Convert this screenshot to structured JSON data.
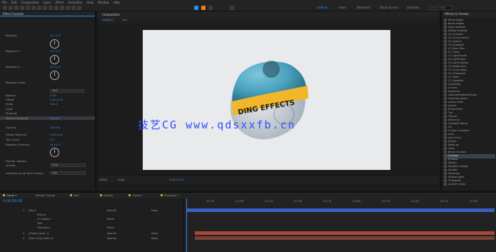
{
  "menubar": {
    "items": [
      "File",
      "Edit",
      "Composition",
      "Layer",
      "Effect",
      "Animation",
      "View",
      "Window",
      "Help"
    ]
  },
  "toolbar": {
    "workspaces": [
      "Default",
      "Learn",
      "Standard",
      "Small Screen",
      "Libraries"
    ],
    "search_placeholder": "Search Help"
  },
  "effect_controls": {
    "tab_label": "Effect Controls",
    "rows": [
      {
        "name": "Rotation",
        "value": "0x+0.0°"
      },
      {
        "name": "Rotation Y",
        "value": "0x+0.0°"
      },
      {
        "name": "Rotation Z",
        "value": "0x+0.0°"
      },
      {
        "name": "Rotation Order",
        "value": "XYZ"
      },
      {
        "name": "Normal",
        "value": "0.00"
      },
      {
        "name": "Offset",
        "value": "0.00,0.00"
      },
      {
        "name": "Scale",
        "value": "100.0"
      },
      {
        "name": "Light",
        "value": ""
      },
      {
        "name": "Shading",
        "value": ""
      },
      {
        "name": "Texture Mapping",
        "value": "Sphere"
      },
      {
        "name": "Opacity",
        "value": "100.0%"
      },
      {
        "name": "Offset (Texture)",
        "value": "0.00,0.00"
      },
      {
        "name": "Tile Count",
        "value": "1.0"
      },
      {
        "name": "Rotation (Texture)",
        "value": "0x+0.0°"
      },
      {
        "name": "Render Options",
        "value": ""
      },
      {
        "name": "Quality",
        "value": "Final"
      },
      {
        "name": "Antialiasing for Best Quality",
        "value": "Low"
      }
    ]
  },
  "viewer": {
    "tab_label": "Composition",
    "sub_tabs": [
      "Comp 1",
      "Text"
    ],
    "zoom": "(50%)",
    "resolution": "(Full)",
    "time": "0;00;00;00",
    "object_text": "DING EFFECTS",
    "watermark": "技艺CG  www.qdsxxfb.cn"
  },
  "effects_panel": {
    "header": "Effects & Presets",
    "items": [
      "Bevel Alpha",
      "Bevel Edges",
      "Drop Shadow",
      "Radial Shadow",
      "CC Cylinder",
      "CC Environment",
      "CC Sphere",
      "CC Spotlight",
      "CC Burn Film",
      "CC Glass",
      "CC Light Burst",
      "CC Light Rays",
      "CC Light Sweep",
      "CC Radial Blur",
      "CC Scale Wipe",
      "CC Threshold",
      "CC Toner",
      "CC Vignette",
      "Colorama",
      "Curves",
      "Exposure",
      "Gamma/Pedestal/Gain",
      "Hue/Saturation",
      "Leave Color",
      "Levels",
      "Photo Filter",
      "Tint",
      "Tritone",
      "Vibrance",
      "Gradient Ramp",
      "Fill",
      "4-Color Gradient",
      "Grid",
      "Lens Flare",
      "Stroke",
      "Write-on",
      "Glow",
      "Brush Strokes",
      "Cartoon",
      "Emboss",
      "Mosaic",
      "Roughen Edges",
      "Scatter",
      "Texturize",
      "Strobe Light",
      "Threshold",
      "Lumetri Color"
    ],
    "selected_index": 38
  },
  "timeline": {
    "tabs": [
      "Comp 1",
      "Render Queue",
      "Text",
      "Sphere",
      "Comp 2",
      "Precomp 1"
    ],
    "timecode": "0;00;00;00",
    "ruler": [
      "00:15f",
      "01:00f",
      "01:15f",
      "02:00f",
      "02:15f",
      "03:00f",
      "03:15f",
      "04:00f",
      "04:15f",
      "05:00f"
    ],
    "layers": [
      {
        "num": "1",
        "name": "[Text]",
        "mode": "Normal",
        "parent": "None"
      },
      {
        "num": "",
        "name": "Effects",
        "mode": "",
        "parent": ""
      },
      {
        "num": "",
        "name": "CC Sphere",
        "mode": "Reset",
        "parent": ""
      },
      {
        "num": "",
        "name": "Text",
        "mode": "",
        "parent": ""
      },
      {
        "num": "",
        "name": "Transform",
        "mode": "Reset",
        "parent": ""
      },
      {
        "num": "2",
        "name": "[Shape Layer 1]",
        "mode": "Normal",
        "parent": "None"
      },
      {
        "num": "3",
        "name": "[Dark Gray Solid 1]",
        "mode": "Normal",
        "parent": "None"
      }
    ]
  },
  "colors": {
    "accent": "#2d8ceb",
    "layer_bar_blue": "#3a5fc4",
    "layer_bar_red": "#a8483a",
    "sphere_main": "#4aa3c0",
    "band": "#f0b72a"
  }
}
